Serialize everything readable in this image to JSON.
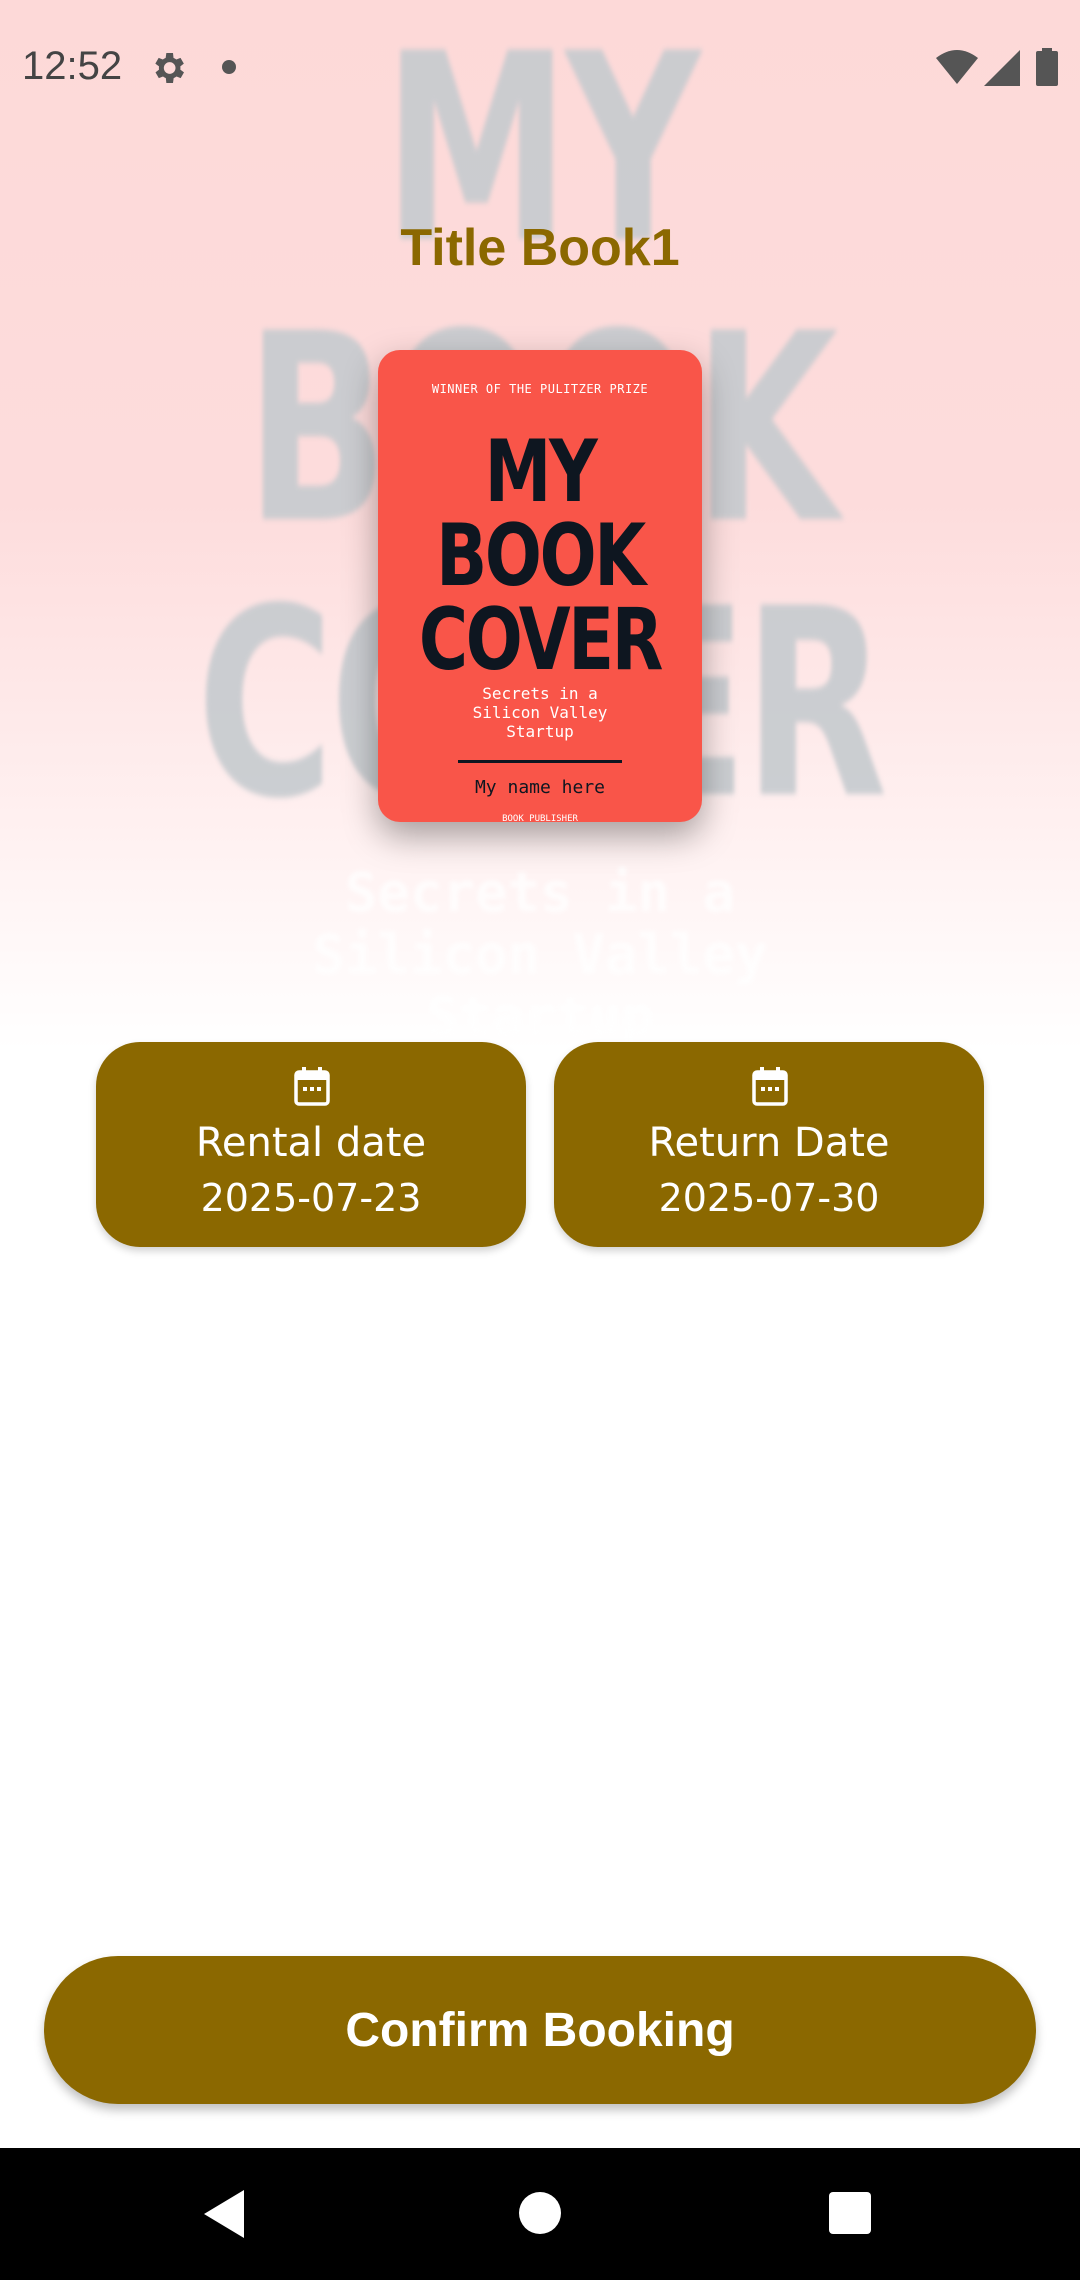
{
  "status_bar": {
    "time": "12:52",
    "icons": [
      "gear-icon",
      "notification-dot",
      "wifi-icon",
      "signal-icon",
      "battery-icon"
    ]
  },
  "book": {
    "title": "Title Book1",
    "cover": {
      "award": "WINNER OF THE PULITZER PRIZE",
      "title_lines": [
        "MY",
        "BOOK",
        "COVER"
      ],
      "subtitle": "Secrets in a\nSilicon Valley\nStartup",
      "author": "My name here",
      "publisher": "BOOK PUBLISHER"
    },
    "background": {
      "title_lines": [
        "MY",
        "BOOK",
        "COVER"
      ],
      "subtitle_lines": [
        "Secrets in a",
        "Silicon Valley",
        "Startup"
      ]
    }
  },
  "rental": {
    "label": "Rental date",
    "date": "2025-07-23",
    "icon": "calendar-icon"
  },
  "return": {
    "label": "Return Date",
    "date": "2025-07-30",
    "icon": "calendar-icon"
  },
  "actions": {
    "confirm_label": "Confirm Booking"
  },
  "navigation": {
    "icons": [
      "back-icon",
      "home-icon",
      "recents-icon"
    ]
  },
  "colors": {
    "accent": "#8b6800",
    "cover": "#f95549",
    "hero_top": "#fdd9d8"
  }
}
